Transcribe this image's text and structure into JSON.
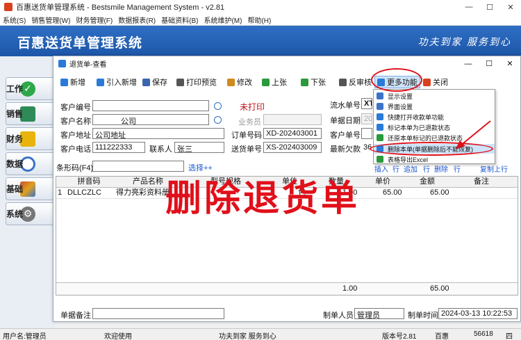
{
  "window": {
    "title": "百惠送货单管理系统 - Bestsmile Management System - v2.81",
    "minimize": "—",
    "maximize": "☐",
    "close": "✕"
  },
  "menubar": [
    "系统(S)",
    "销售管理(W)",
    "财务管理(F)",
    "数据报表(R)",
    "基础资料(B)",
    "系统维护(M)",
    "帮助(H)"
  ],
  "banner": {
    "title": "百惠送货单管理系统",
    "slogan": "功夫到家 服务到心"
  },
  "leftnav": [
    {
      "label": "工作",
      "icon": "check-icon",
      "color": "#2fa84a"
    },
    {
      "label": "销售",
      "icon": "sales-icon",
      "color": "#2e8b57"
    },
    {
      "label": "财务",
      "icon": "folder-icon",
      "color": "#e8b30d"
    },
    {
      "label": "数据",
      "icon": "search-icon",
      "color": "#3b73c8"
    },
    {
      "label": "基础",
      "icon": "basic-icon",
      "color": "#c94f2d"
    },
    {
      "label": "系统",
      "icon": "gear-icon",
      "color": "#777777"
    }
  ],
  "child": {
    "title": "退货单-查看",
    "minimize": "—",
    "maximize": "☐",
    "close": "✕",
    "toolbar": [
      {
        "label": "新增",
        "icon": "plus-icon",
        "color": "#2a7ad8"
      },
      {
        "label": "引入新增",
        "icon": "plus-icon",
        "color": "#2a7ad8"
      },
      {
        "label": "保存",
        "icon": "save-icon",
        "color": "#3a66b0"
      },
      {
        "label": "打印预览",
        "icon": "print-icon",
        "color": "#555555"
      },
      {
        "label": "修改",
        "icon": "edit-icon",
        "color": "#d08a1e"
      },
      {
        "label": "上张",
        "icon": "prev-icon",
        "color": "#2a9a3a"
      },
      {
        "label": "下张",
        "icon": "next-icon",
        "color": "#2a9a3a"
      },
      {
        "label": "反审核",
        "icon": "unaudit-icon",
        "color": "#555555"
      },
      {
        "label": "更多功能",
        "icon": "more-icon",
        "color": "#2a7ad8"
      },
      {
        "label": "关闭",
        "icon": "close-icon",
        "color": "#d9411e"
      }
    ],
    "form": {
      "customer_code_label": "客户编号",
      "customer_code": "",
      "print_status": "未打印",
      "serial_label": "流水单号",
      "serial_value": "XT",
      "customer_name_label": "客户名称",
      "customer_name": "公司",
      "salesman_label": "业务员",
      "salesman": "",
      "bill_date_label": "单据日期",
      "bill_date": "20",
      "address_label": "客户地址",
      "address": "公司地址",
      "order_no_label": "订单号码",
      "order_no": "XD-202403001",
      "customer_bill_label": "客户单号",
      "customer_bill": "",
      "phone_label": "客户电话",
      "phone": "111222333",
      "contact_label": "联系人",
      "contact": "张三",
      "delivery_no_label": "送货单号",
      "delivery_no": "XS-202403009",
      "latest_debt_label": "最新欠款",
      "latest_debt": "36",
      "barcode_label": "条形码(F4)",
      "barcode": "",
      "select_link": "选择++",
      "row_actions": [
        "插入",
        "行",
        "追加",
        "行",
        "删除",
        "行",
        "复制上行"
      ]
    },
    "grid": {
      "headers": [
        "拼音码",
        "产品名称",
        "型号规格",
        "单位",
        "数量",
        "单价",
        "金额",
        "备注"
      ],
      "rows": [
        {
          "no": "1",
          "pinyin": "DLLCZLC",
          "product": "得力亮彩资料册",
          "spec": "",
          "unit": "包",
          "qty": "1.00",
          "price": "65.00",
          "amount": "65.00",
          "note": ""
        }
      ],
      "total_qty": "1.00",
      "total_amount": "65.00"
    },
    "footer": {
      "remark_label": "单据备注",
      "remark": "",
      "maker_label": "制单人员",
      "maker": "管理员",
      "make_time_label": "制单时间",
      "make_time": "2024-03-13 10:22:53"
    }
  },
  "dropdown": [
    "显示设置",
    "界面设置",
    "快捷打开收款单功能",
    "标记本单为已退款状态",
    "还原本单标记的已退款状态",
    "删除本单(单据删除后不能恢复)",
    "表格导出Excel"
  ],
  "overlay": "删除退货单",
  "statusbar": {
    "user": "用户名:管理员",
    "welcome": "欢迎使用",
    "slogan": "功夫到家 服务到心",
    "version": "版本号2.81",
    "company": "百惠",
    "count": "56618",
    "weekday": "四"
  }
}
